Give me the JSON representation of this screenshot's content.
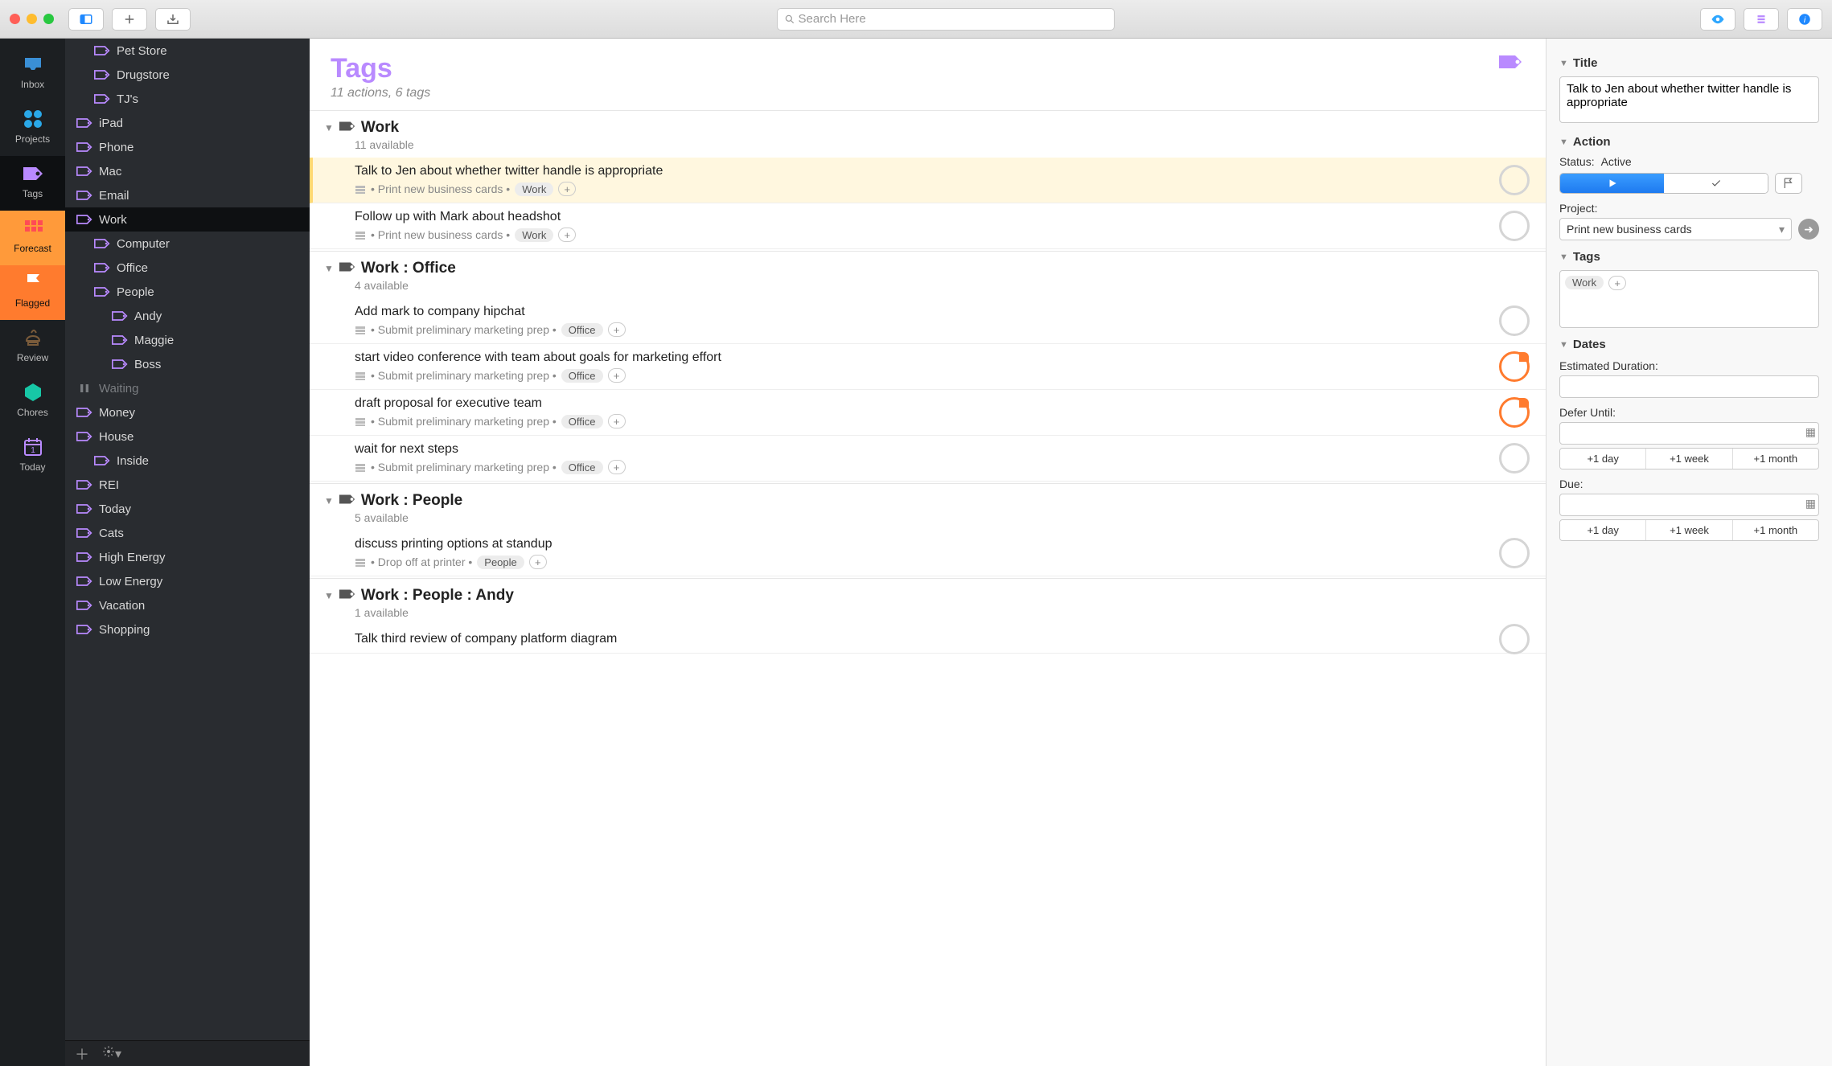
{
  "toolbar": {
    "search_placeholder": "Search Here"
  },
  "perspectives": [
    {
      "id": "inbox",
      "label": "Inbox",
      "color": "#3a8fd6"
    },
    {
      "id": "projects",
      "label": "Projects",
      "color": "#2aa8e8"
    },
    {
      "id": "tags",
      "label": "Tags",
      "color": "#b98aff",
      "selected": true
    },
    {
      "id": "forecast",
      "label": "Forecast",
      "color": "#ff4b55",
      "bg": "fc"
    },
    {
      "id": "flagged",
      "label": "Flagged",
      "color": "#ffffff",
      "bg": "flag"
    },
    {
      "id": "review",
      "label": "Review",
      "color": "#7a5b3a"
    },
    {
      "id": "chores",
      "label": "Chores",
      "color": "#17c7a6"
    },
    {
      "id": "today",
      "label": "Today",
      "color": "#b98aff"
    }
  ],
  "sidebar": [
    {
      "label": "Pet Store",
      "depth": 1
    },
    {
      "label": "Drugstore",
      "depth": 1
    },
    {
      "label": "TJ's",
      "depth": 1
    },
    {
      "label": "iPad",
      "depth": 0
    },
    {
      "label": "Phone",
      "depth": 0
    },
    {
      "label": "Mac",
      "depth": 0
    },
    {
      "label": "Email",
      "depth": 0
    },
    {
      "label": "Work",
      "depth": 0,
      "selected": true
    },
    {
      "label": "Computer",
      "depth": 1
    },
    {
      "label": "Office",
      "depth": 1
    },
    {
      "label": "People",
      "depth": 1
    },
    {
      "label": "Andy",
      "depth": 2
    },
    {
      "label": "Maggie",
      "depth": 2
    },
    {
      "label": "Boss",
      "depth": 2
    },
    {
      "label": "Waiting",
      "depth": 0,
      "dim": true,
      "icon": "pause"
    },
    {
      "label": "Money",
      "depth": 0
    },
    {
      "label": "House",
      "depth": 0
    },
    {
      "label": "Inside",
      "depth": 1
    },
    {
      "label": "REI",
      "depth": 0
    },
    {
      "label": "Today",
      "depth": 0
    },
    {
      "label": "Cats",
      "depth": 0
    },
    {
      "label": "High Energy",
      "depth": 0
    },
    {
      "label": "Low Energy",
      "depth": 0
    },
    {
      "label": "Vacation",
      "depth": 0
    },
    {
      "label": "Shopping",
      "depth": 0
    }
  ],
  "outline": {
    "title": "Tags",
    "subtitle": "11 actions, 6 tags",
    "groups": [
      {
        "title": "Work",
        "sub": "11 available",
        "items": [
          {
            "title": "Talk to Jen about whether twitter handle is appropriate",
            "project": "Print new business cards",
            "tags": [
              "Work"
            ],
            "selected": true,
            "status": "open"
          },
          {
            "title": "Follow up with Mark about headshot",
            "project": "Print new business cards",
            "tags": [
              "Work"
            ],
            "status": "open"
          }
        ]
      },
      {
        "title": "Work : Office",
        "sub": "4 available",
        "items": [
          {
            "title": "Add mark to company hipchat",
            "project": "Submit preliminary marketing prep",
            "tags": [
              "Office"
            ],
            "status": "open"
          },
          {
            "title": "start video conference with team about goals for marketing effort",
            "project": "Submit preliminary marketing prep",
            "tags": [
              "Office"
            ],
            "status": "repeat"
          },
          {
            "title": "draft proposal for executive team",
            "project": "Submit preliminary marketing prep",
            "tags": [
              "Office"
            ],
            "status": "repeat"
          },
          {
            "title": "wait for next steps",
            "project": "Submit preliminary marketing prep",
            "tags": [
              "Office"
            ],
            "status": "open"
          }
        ]
      },
      {
        "title": "Work : People",
        "sub": "5 available",
        "items": [
          {
            "title": "discuss printing options at standup",
            "project": "Drop off at printer",
            "tags": [
              "People"
            ],
            "status": "open"
          }
        ]
      },
      {
        "title": "Work : People : Andy",
        "sub": "1 available",
        "items": [
          {
            "title": "Talk third review of company platform diagram",
            "project": "",
            "tags": [],
            "status": "open",
            "nometa": true
          }
        ]
      }
    ]
  },
  "inspector": {
    "title_label": "Title",
    "title_value": "Talk to Jen about whether twitter handle is appropriate",
    "action_label": "Action",
    "status_label": "Status:",
    "status_value": "Active",
    "project_label": "Project:",
    "project_value": "Print new business cards",
    "tags_label": "Tags",
    "tags": [
      "Work"
    ],
    "dates_label": "Dates",
    "estdur_label": "Estimated Duration:",
    "defer_label": "Defer Until:",
    "due_label": "Due:",
    "quick": [
      "+1 day",
      "+1 week",
      "+1 month"
    ]
  }
}
